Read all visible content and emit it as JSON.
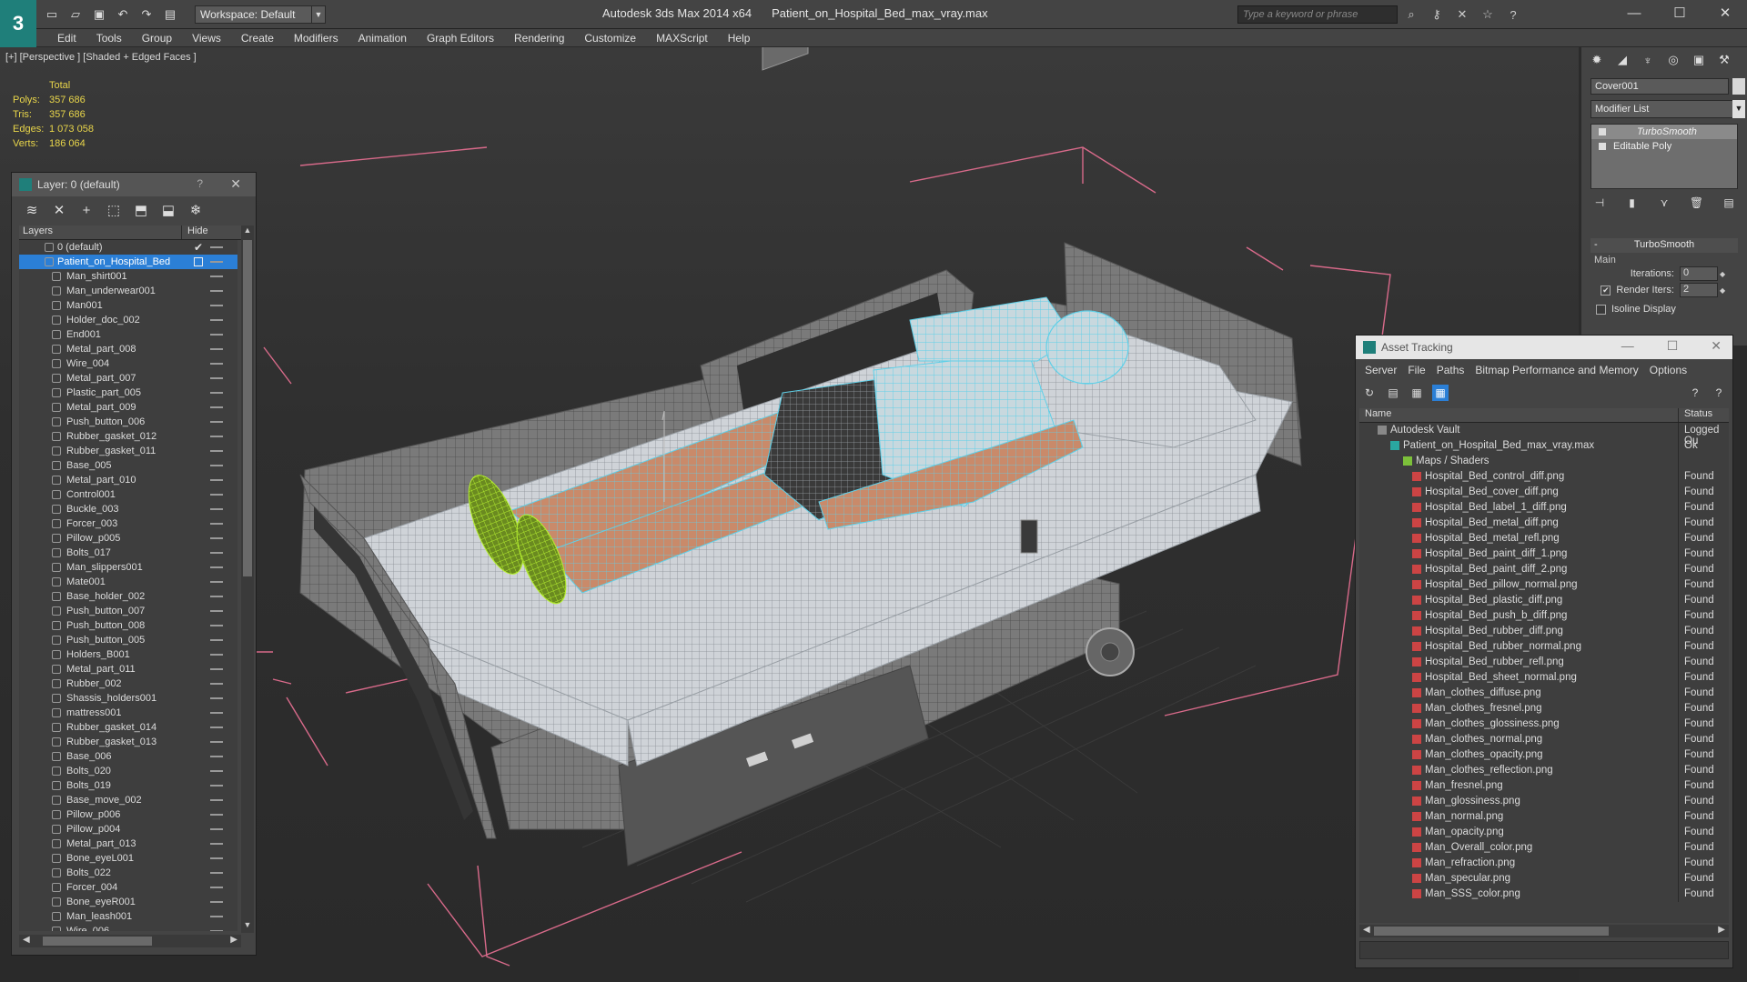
{
  "app": {
    "title": "Autodesk 3ds Max  2014 x64",
    "file": "Patient_on_Hospital_Bed_max_vray.max",
    "workspace": "Workspace: Default",
    "search_placeholder": "Type a keyword or phrase"
  },
  "menu": [
    "Edit",
    "Tools",
    "Group",
    "Views",
    "Create",
    "Modifiers",
    "Animation",
    "Graph Editors",
    "Rendering",
    "Customize",
    "MAXScript",
    "Help"
  ],
  "viewport": {
    "label": "[+] [Perspective ] [Shaded + Edged Faces ]",
    "stats_header": "Total",
    "stats": [
      {
        "key": "Polys:",
        "value": "357 686"
      },
      {
        "key": "Tris:",
        "value": "357 686"
      },
      {
        "key": "Edges:",
        "value": "1 073 058"
      },
      {
        "key": "Verts:",
        "value": "186 064"
      }
    ]
  },
  "layer_window": {
    "title": "Layer: 0 (default)",
    "help": "?",
    "col_layers": "Layers",
    "col_hide": "Hide",
    "top_layers": [
      {
        "name": "0 (default)",
        "selected": false,
        "checked": true
      },
      {
        "name": "Patient_on_Hospital_Bed",
        "selected": true,
        "checked": false
      }
    ],
    "objects": [
      "Man_shirt001",
      "Man_underwear001",
      "Man001",
      "Holder_doc_002",
      "End001",
      "Metal_part_008",
      "Wire_004",
      "Metal_part_007",
      "Plastic_part_005",
      "Metal_part_009",
      "Push_button_006",
      "Rubber_gasket_012",
      "Rubber_gasket_011",
      "Base_005",
      "Metal_part_010",
      "Control001",
      "Buckle_003",
      "Forcer_003",
      "Pillow_p005",
      "Bolts_017",
      "Man_slippers001",
      "Mate001",
      "Base_holder_002",
      "Push_button_007",
      "Push_button_008",
      "Push_button_005",
      "Holders_B001",
      "Metal_part_011",
      "Rubber_002",
      "Shassis_holders001",
      "mattress001",
      "Rubber_gasket_014",
      "Rubber_gasket_013",
      "Base_006",
      "Bolts_020",
      "Bolts_019",
      "Base_move_002",
      "Pillow_p006",
      "Pillow_p004",
      "Metal_part_013",
      "Bone_eyeL001",
      "Bolts_022",
      "Forcer_004",
      "Bone_eyeR001",
      "Man_leash001",
      "Wire_006"
    ]
  },
  "command_panel": {
    "object_name": "Cover001",
    "modifier_list": "Modifier List",
    "stack": [
      "TurboSmooth",
      "Editable Poly"
    ],
    "rollout": "TurboSmooth",
    "group": "Main",
    "iterations_label": "Iterations:",
    "iterations_value": "0",
    "render_iters_label": "Render Iters:",
    "render_iters_value": "2",
    "render_iters_checked": true,
    "isoline_label": "Isoline Display",
    "isoline_checked": false
  },
  "asset_tracking": {
    "title": "Asset Tracking",
    "menu": [
      "Server",
      "File",
      "Paths",
      "Bitmap Performance and Memory",
      "Options"
    ],
    "col_name": "Name",
    "col_status": "Status",
    "rows": [
      {
        "name": "Autodesk Vault",
        "status": "Logged Ou",
        "level": 0,
        "icon": "vault"
      },
      {
        "name": "Patient_on_Hospital_Bed_max_vray.max",
        "status": "Ok",
        "level": 1,
        "icon": "max"
      },
      {
        "name": "Maps / Shaders",
        "status": "",
        "level": 2,
        "icon": "folder"
      },
      {
        "name": "Hospital_Bed_control_diff.png",
        "status": "Found",
        "level": 3,
        "icon": "png"
      },
      {
        "name": "Hospital_Bed_cover_diff.png",
        "status": "Found",
        "level": 3,
        "icon": "png"
      },
      {
        "name": "Hospital_Bed_label_1_diff.png",
        "status": "Found",
        "level": 3,
        "icon": "png"
      },
      {
        "name": "Hospital_Bed_metal_diff.png",
        "status": "Found",
        "level": 3,
        "icon": "png"
      },
      {
        "name": "Hospital_Bed_metal_refl.png",
        "status": "Found",
        "level": 3,
        "icon": "png"
      },
      {
        "name": "Hospital_Bed_paint_diff_1.png",
        "status": "Found",
        "level": 3,
        "icon": "png"
      },
      {
        "name": "Hospital_Bed_paint_diff_2.png",
        "status": "Found",
        "level": 3,
        "icon": "png"
      },
      {
        "name": "Hospital_Bed_pillow_normal.png",
        "status": "Found",
        "level": 3,
        "icon": "png"
      },
      {
        "name": "Hospital_Bed_plastic_diff.png",
        "status": "Found",
        "level": 3,
        "icon": "png"
      },
      {
        "name": "Hospital_Bed_push_b_diff.png",
        "status": "Found",
        "level": 3,
        "icon": "png"
      },
      {
        "name": "Hospital_Bed_rubber_diff.png",
        "status": "Found",
        "level": 3,
        "icon": "png"
      },
      {
        "name": "Hospital_Bed_rubber_normal.png",
        "status": "Found",
        "level": 3,
        "icon": "png"
      },
      {
        "name": "Hospital_Bed_rubber_refl.png",
        "status": "Found",
        "level": 3,
        "icon": "png"
      },
      {
        "name": "Hospital_Bed_sheet_normal.png",
        "status": "Found",
        "level": 3,
        "icon": "png"
      },
      {
        "name": "Man_clothes_diffuse.png",
        "status": "Found",
        "level": 3,
        "icon": "png"
      },
      {
        "name": "Man_clothes_fresnel.png",
        "status": "Found",
        "level": 3,
        "icon": "png"
      },
      {
        "name": "Man_clothes_glossiness.png",
        "status": "Found",
        "level": 3,
        "icon": "png"
      },
      {
        "name": "Man_clothes_normal.png",
        "status": "Found",
        "level": 3,
        "icon": "png"
      },
      {
        "name": "Man_clothes_opacity.png",
        "status": "Found",
        "level": 3,
        "icon": "png"
      },
      {
        "name": "Man_clothes_reflection.png",
        "status": "Found",
        "level": 3,
        "icon": "png"
      },
      {
        "name": "Man_fresnel.png",
        "status": "Found",
        "level": 3,
        "icon": "png"
      },
      {
        "name": "Man_glossiness.png",
        "status": "Found",
        "level": 3,
        "icon": "png"
      },
      {
        "name": "Man_normal.png",
        "status": "Found",
        "level": 3,
        "icon": "png"
      },
      {
        "name": "Man_opacity.png",
        "status": "Found",
        "level": 3,
        "icon": "png"
      },
      {
        "name": "Man_Overall_color.png",
        "status": "Found",
        "level": 3,
        "icon": "png"
      },
      {
        "name": "Man_refraction.png",
        "status": "Found",
        "level": 3,
        "icon": "png"
      },
      {
        "name": "Man_specular.png",
        "status": "Found",
        "level": 3,
        "icon": "png"
      },
      {
        "name": "Man_SSS_color.png",
        "status": "Found",
        "level": 3,
        "icon": "png"
      }
    ]
  },
  "colors": {
    "accent_select": "#2b7fd6",
    "stats_text": "#e8d54a",
    "wire_cyan": "#5fd0e8",
    "wire_green": "#9be020",
    "bbox_pink": "#d86a8a",
    "skin": "#c98a6a"
  },
  "icons": {
    "qat": [
      "new-file-icon",
      "open-file-icon",
      "save-icon",
      "undo-icon",
      "redo-icon",
      "project-folder-icon"
    ],
    "search_tools": [
      "binoculars-icon",
      "key-icon",
      "communication-icon",
      "favorites-icon",
      "help-icon"
    ],
    "window": [
      "minimize-icon",
      "maximize-icon",
      "close-icon"
    ],
    "command_tabs": [
      "create-icon",
      "modify-icon",
      "hierarchy-icon",
      "motion-icon",
      "display-icon",
      "utilities-icon"
    ]
  }
}
